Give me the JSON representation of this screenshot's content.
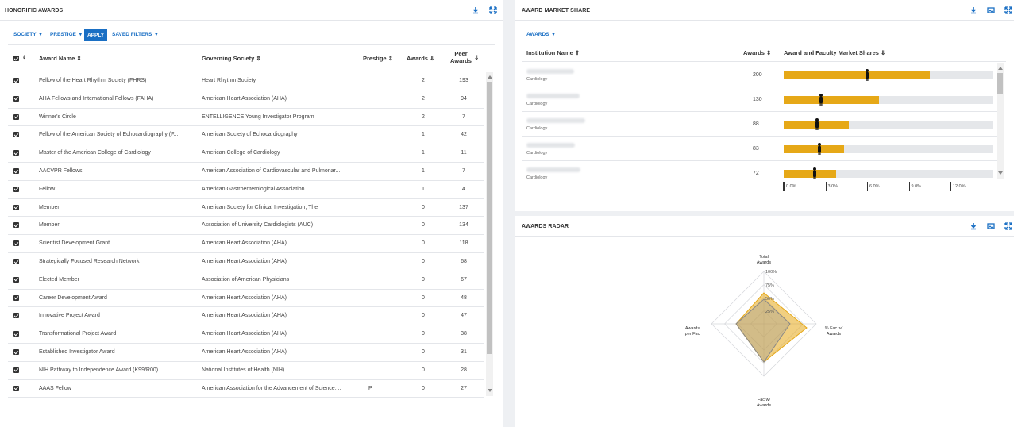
{
  "left": {
    "title": "HONORIFIC AWARDS",
    "filters": {
      "society": "SOCIETY",
      "prestige": "PRESTIGE",
      "apply": "APPLY",
      "saved": "SAVED FILTERS"
    },
    "columns": {
      "name": "Award Name",
      "society": "Governing Society",
      "prestige": "Prestige",
      "awards": "Awards",
      "peer1": "Peer",
      "peer2": "Awards"
    },
    "rows": [
      {
        "name": "Fellow of the Heart Rhythm Society (FHRS)",
        "society": "Heart Rhythm Society",
        "prestige": "",
        "awards": "2",
        "peer": "193"
      },
      {
        "name": "AHA Fellows and International Fellows (FAHA)",
        "society": "American Heart Association (AHA)",
        "prestige": "",
        "awards": "2",
        "peer": "94"
      },
      {
        "name": "Winner's Circle",
        "society": "ENTELLIGENCE Young Investigator Program",
        "prestige": "",
        "awards": "2",
        "peer": "7"
      },
      {
        "name": "Fellow of the American Society of Echocardiography (F...",
        "society": "American Society of Echocardiography",
        "prestige": "",
        "awards": "1",
        "peer": "42"
      },
      {
        "name": "Master of the American College of Cardiology",
        "society": "American College of Cardiology",
        "prestige": "",
        "awards": "1",
        "peer": "11"
      },
      {
        "name": "AACVPR Fellows",
        "society": "American Association of Cardiovascular and Pulmonar...",
        "prestige": "",
        "awards": "1",
        "peer": "7"
      },
      {
        "name": "Fellow",
        "society": "American Gastroenterological Association",
        "prestige": "",
        "awards": "1",
        "peer": "4"
      },
      {
        "name": "Member",
        "society": "American Society for Clinical Investigation, The",
        "prestige": "",
        "awards": "0",
        "peer": "137"
      },
      {
        "name": "Member",
        "society": "Association of University Cardiologists (AUC)",
        "prestige": "",
        "awards": "0",
        "peer": "134"
      },
      {
        "name": "Scientist Development Grant",
        "society": "American Heart Association (AHA)",
        "prestige": "",
        "awards": "0",
        "peer": "118"
      },
      {
        "name": "Strategically Focused Research Network",
        "society": "American Heart Association (AHA)",
        "prestige": "",
        "awards": "0",
        "peer": "68"
      },
      {
        "name": "Elected Member",
        "society": "Association of American Physicians",
        "prestige": "",
        "awards": "0",
        "peer": "67"
      },
      {
        "name": "Career Development Award",
        "society": "American Heart Association (AHA)",
        "prestige": "",
        "awards": "0",
        "peer": "48"
      },
      {
        "name": "Innovative Project Award",
        "society": "American Heart Association (AHA)",
        "prestige": "",
        "awards": "0",
        "peer": "47"
      },
      {
        "name": "Transformational Project Award",
        "society": "American Heart Association (AHA)",
        "prestige": "",
        "awards": "0",
        "peer": "38"
      },
      {
        "name": "Established Investigator Award",
        "society": "American Heart Association (AHA)",
        "prestige": "",
        "awards": "0",
        "peer": "31"
      },
      {
        "name": "NIH Pathway to Independence Award (K99/R00)",
        "society": "National Institutes of Health (NIH)",
        "prestige": "",
        "awards": "0",
        "peer": "28"
      },
      {
        "name": "AAAS Fellow",
        "society": "American Association for the Advancement of Science,...",
        "prestige": "P",
        "awards": "0",
        "peer": "27"
      }
    ]
  },
  "market": {
    "title": "AWARD MARKET SHARE",
    "filter": "AWARDS",
    "columns": {
      "inst": "Institution Name",
      "awards": "Awards",
      "shares": "Award and Faculty Market Shares"
    },
    "rows": [
      {
        "dept": "Cardiology",
        "awards": "200",
        "fill": 0.7,
        "marker": 0.4
      },
      {
        "dept": "Cardiology",
        "awards": "130",
        "fill": 0.455,
        "marker": 0.18
      },
      {
        "dept": "Cardiology",
        "awards": "88",
        "fill": 0.31,
        "marker": 0.16
      },
      {
        "dept": "Cardiology",
        "awards": "83",
        "fill": 0.29,
        "marker": 0.17
      },
      {
        "dept": "Cardiology",
        "awards": "72",
        "fill": 0.25,
        "marker": 0.15
      }
    ],
    "axis": [
      "0.0%",
      "3.0%",
      "6.0%",
      "9.0%",
      "12.0%"
    ]
  },
  "radar": {
    "title": "AWARDS RADAR",
    "labels": {
      "top1": "Total",
      "top2": "Awards",
      "right1": "% Fac w/",
      "right2": "Awards",
      "bottom1": "Fac w/",
      "bottom2": "Awards",
      "left1": "Awards",
      "left2": "per Fac"
    },
    "ticks": [
      "100%",
      "75%",
      "50%",
      "25%"
    ],
    "colors": {
      "fill": "#e6a817",
      "peer": "#999999"
    }
  }
}
